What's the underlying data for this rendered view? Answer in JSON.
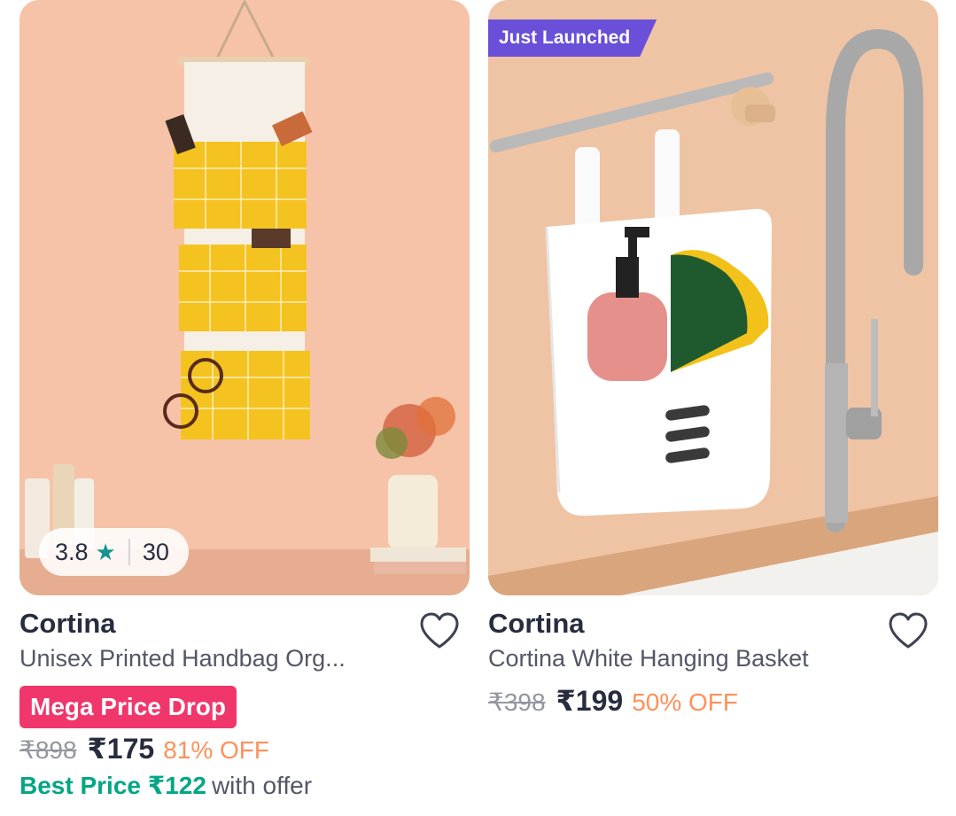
{
  "products": [
    {
      "brand": "Cortina",
      "title": "Unisex Printed Handbag Org...",
      "image_icon": "wall-hanging-organizer-image",
      "rating": "3.8",
      "rating_count": "30",
      "badge": "Mega Price Drop",
      "mrp": "₹898",
      "price": "₹175",
      "discount": "81% OFF",
      "best_price_label": "Best Price ₹122",
      "best_price_suffix": "with offer"
    },
    {
      "brand": "Cortina",
      "title": "Cortina White Hanging Basket",
      "image_icon": "hanging-basket-image",
      "tag": "Just Launched",
      "mrp": "₹398",
      "price": "₹199",
      "discount": "50% OFF"
    }
  ],
  "colors": {
    "accent_pink": "#f0366b",
    "launched_purple": "#6a4fd8",
    "discount_orange": "#ff905a",
    "best_price_green": "#03a685",
    "rating_star": "#14958f"
  }
}
